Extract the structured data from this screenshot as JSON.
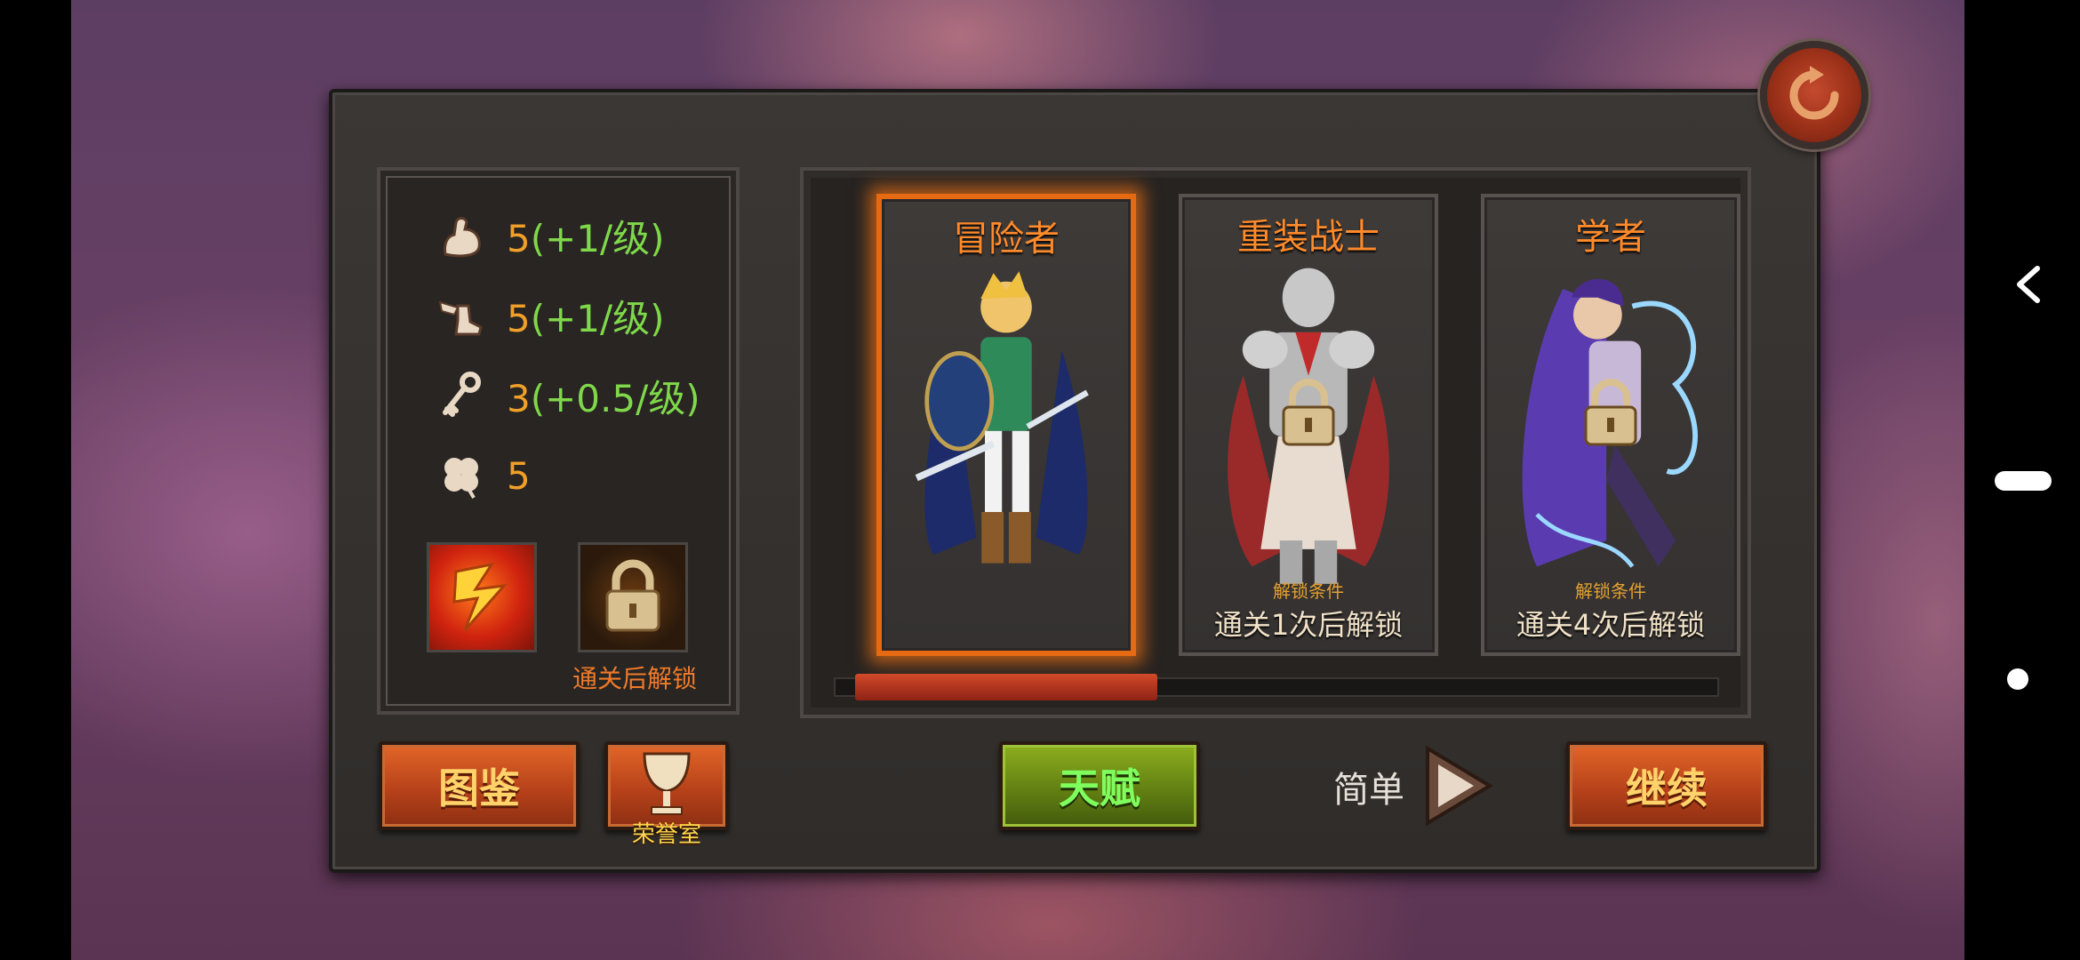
{
  "stats": [
    {
      "icon": "strength-arm-icon",
      "base": "5",
      "bonus": "(+1/级)"
    },
    {
      "icon": "winged-boot-icon",
      "base": "5",
      "bonus": "(+1/级)"
    },
    {
      "icon": "key-icon",
      "base": "3",
      "bonus": "(+0.5/级)"
    },
    {
      "icon": "clover-luck-icon",
      "base": "5",
      "bonus": ""
    }
  ],
  "skills": {
    "caption": "通关后解锁"
  },
  "characters": [
    {
      "name": "冒险者",
      "selected": true,
      "locked": false,
      "unlock_condition_label": "",
      "unlock_text": ""
    },
    {
      "name": "重装战士",
      "selected": false,
      "locked": true,
      "unlock_condition_label": "解锁条件",
      "unlock_text": "通关1次后解锁"
    },
    {
      "name": "学者",
      "selected": false,
      "locked": true,
      "unlock_condition_label": "解锁条件",
      "unlock_text": "通关4次后解锁"
    }
  ],
  "buttons": {
    "codex": "图鉴",
    "honor_room": "荣誉室",
    "talent": "天赋",
    "difficulty": "简单",
    "continue": "继续"
  },
  "colors": {
    "accent_orange": "#e66a12",
    "stat_green": "#7fd84a",
    "stat_orange": "#f0a028"
  }
}
